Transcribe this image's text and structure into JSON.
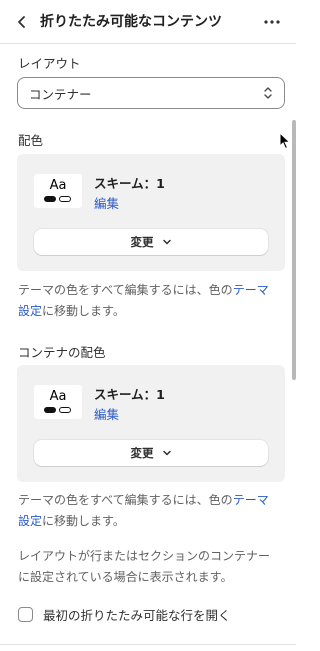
{
  "header": {
    "title": "折りたたみ可能なコンテンツ",
    "back_icon": "chevron-left-icon",
    "more_icon": "more-horizontal-icon"
  },
  "layout": {
    "label": "レイアウト",
    "selected_value": "コンテナー"
  },
  "color_scheme": {
    "label": "配色",
    "swatch_text": "Aa",
    "scheme_name": "スキーム：1",
    "edit_label": "編集",
    "change_label": "変更",
    "help_prefix": "テーマの色をすべて編集するには、色の",
    "help_link": "テーマ設定",
    "help_suffix": "に移動します。"
  },
  "container_color_scheme": {
    "label": "コンテナの配色",
    "swatch_text": "Aa",
    "scheme_name": "スキーム：1",
    "edit_label": "編集",
    "change_label": "変更",
    "help_prefix": "テーマの色をすべて編集するには、色の",
    "help_link": "テーマ設定",
    "help_suffix": "に移動します。",
    "visibility_note": "レイアウトが行またはセクションのコンテナーに設定されている場合に表示されます。"
  },
  "open_first_row": {
    "label": "最初の折りたたみ可能な行を開く",
    "checked": false
  },
  "colors": {
    "link": "#2a5bc7",
    "card_background": "#f1f1f1",
    "text": "#303030"
  }
}
